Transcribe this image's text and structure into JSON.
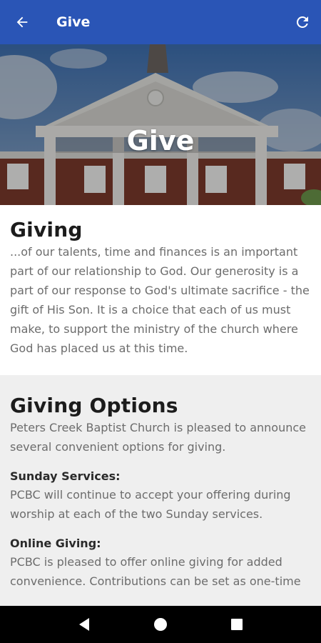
{
  "app_bar": {
    "title": "Give",
    "back_icon": "arrow-left-icon",
    "refresh_icon": "refresh-icon",
    "color": "#2a55b6"
  },
  "hero": {
    "title": "Give"
  },
  "giving": {
    "heading": "Giving",
    "body": "...of our talents, time and finances is an important part of our relationship to God. Our generosity is a part of our response to God's ultimate sacrifice - the gift of His Son. It is a choice that each of us must make, to support the ministry of the church where God has placed us at this time."
  },
  "giving_options": {
    "heading": "Giving Options",
    "intro": "Peters Creek Baptist Church is pleased to announce several convenient options for giving.",
    "sunday_heading": "Sunday Services:",
    "sunday_body": "PCBC will continue to accept your offering during worship at each of the two Sunday services.",
    "online_heading": "Online Giving:",
    "online_body": "PCBC is pleased to offer online giving for added convenience. Contributions can be set as one-time"
  },
  "nav": {
    "back_icon": "triangle-back-icon",
    "home_icon": "circle-home-icon",
    "recents_icon": "square-recents-icon"
  }
}
